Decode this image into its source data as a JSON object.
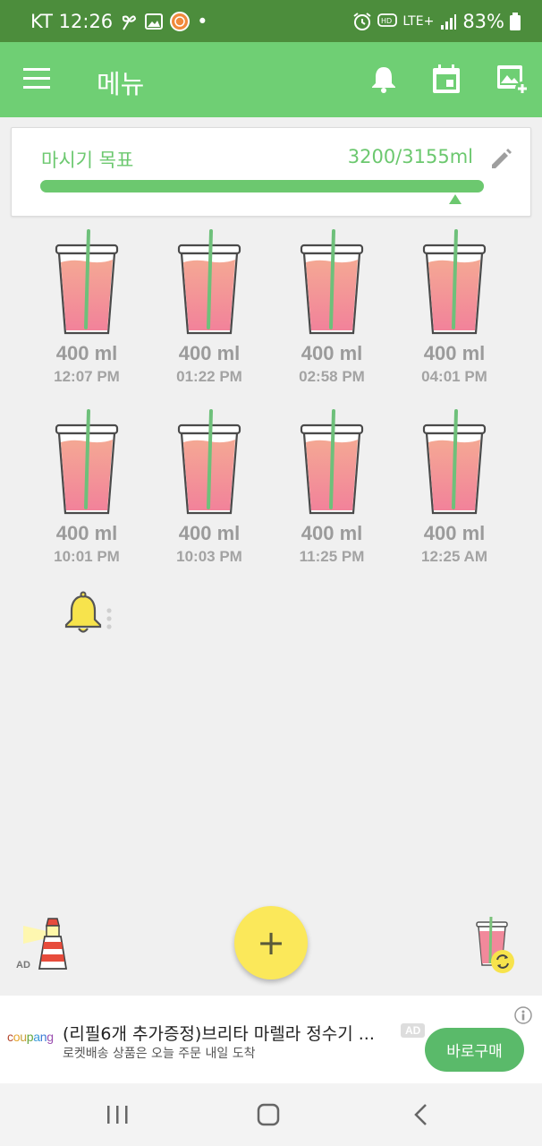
{
  "status_bar": {
    "carrier_time": "KT 12:26",
    "dot": "•",
    "network": "LTE+",
    "battery": "83%",
    "icons": [
      "fan-icon",
      "image-icon",
      "app-notification-icon",
      "alarm-icon",
      "hd-voice-icon",
      "signal-icon",
      "battery-icon"
    ]
  },
  "app_bar": {
    "title": "메뉴",
    "icons": [
      "hamburger-menu-icon",
      "bell-icon",
      "calendar-icon",
      "add-image-icon"
    ]
  },
  "goal": {
    "label": "마시기 목표",
    "value": "3200/3155ml",
    "progress_fraction": 1.0,
    "edit_icon": "pencil-icon"
  },
  "drinks": [
    {
      "amount": "400 ml",
      "time": "12:07 PM"
    },
    {
      "amount": "400 ml",
      "time": "01:22 PM"
    },
    {
      "amount": "400 ml",
      "time": "02:58 PM"
    },
    {
      "amount": "400 ml",
      "time": "04:01 PM"
    },
    {
      "amount": "400 ml",
      "time": "10:01 PM"
    },
    {
      "amount": "400 ml",
      "time": "10:03 PM"
    },
    {
      "amount": "400 ml",
      "time": "11:25 PM"
    },
    {
      "amount": "400 ml",
      "time": "12:25 AM"
    }
  ],
  "bottom": {
    "ad_label": "AD",
    "fab_symbol": "+"
  },
  "ad": {
    "brand": "coupang",
    "title": "(리필6개 추가증정)브리타 마렐라 정수기 ...",
    "badge": "AD",
    "subtitle": "로켓배송 상품은 오늘 주문 내일 도착",
    "cta": "바로구매"
  },
  "colors": {
    "status_bar": "#4c8d3c",
    "app_bar": "#6fcf74",
    "accent": "#6cc86f",
    "fab": "#fbe85a",
    "drink": "#f2899b",
    "cta": "#5aba6a"
  }
}
